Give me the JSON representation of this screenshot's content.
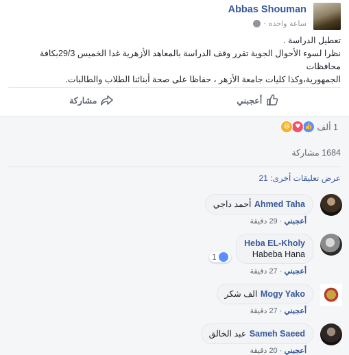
{
  "post": {
    "author": "Abbas Shouman",
    "time": "ساعة واحده",
    "line1": "تعطيل الدراسة .",
    "line2": "نظرا لسوء الأحوال الجوية تقرر وقف الدراسة بالمعاهد الأزهرية غدا الخميس 29/3بكافة محافظات",
    "line3": "الجمهورية،وكذا كليات جامعة الأزهر ، حفاظا على صحة أبنائنا الطلاب والطالبات.",
    "like_label": "أعجبني",
    "share_label": "مشاركة"
  },
  "reactions": {
    "count": "1 ألف",
    "icons": [
      "like-icon",
      "love-icon",
      "haha-icon"
    ]
  },
  "shares": "1684 مشاركة",
  "more_comments": "عرض تعليقات أخرى: 21",
  "comments": [
    {
      "name": "Ahmed Taha",
      "text": "أحمد داجي",
      "like": "أعجبني",
      "time": "29 دقيقة"
    },
    {
      "name": "Heba EL-Kholy",
      "text": "Habeba Hana",
      "like": "أعجبني",
      "time": "27 دقيقة",
      "reactions": "1"
    },
    {
      "name": "Mogy Yako",
      "text": "الف شكر",
      "like": "أعجبني",
      "time": "27 دقيقة"
    },
    {
      "name": "Sameh Saeed",
      "text": "عبد الخالق",
      "like": "أعجبني",
      "time": "20 دقيقة"
    }
  ],
  "colors": {
    "link": "#385898",
    "like_blue": "#5890ff",
    "background": "#f5f6f7"
  }
}
